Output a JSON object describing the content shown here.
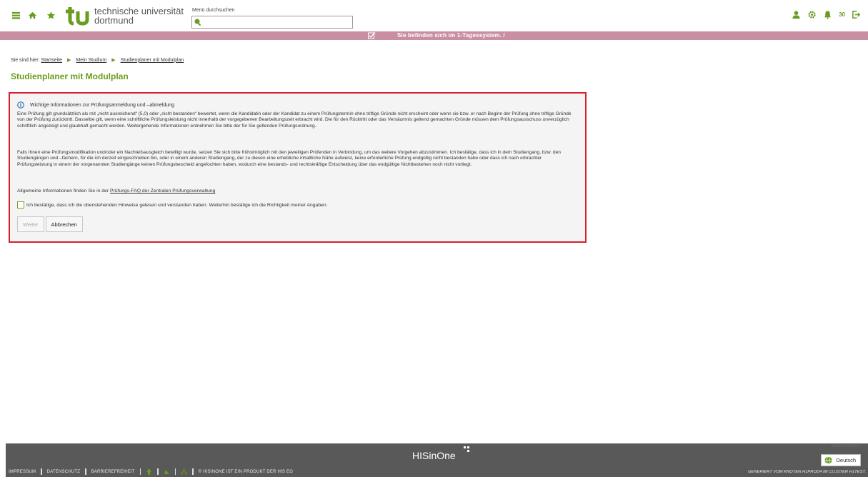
{
  "header": {
    "logo_line1": "technische universität",
    "logo_line2": "dortmund",
    "search_label": "Menü durchsuchen",
    "search_value": "",
    "notification_count": "30",
    "icons": [
      "menu-icon",
      "home-icon",
      "star-icon",
      "search-icon",
      "user-icon",
      "gear-icon",
      "bell-icon",
      "logout-icon"
    ]
  },
  "system_bar": {
    "text": "Sie befinden sich im 1-Tagessystem. /",
    "color": "#c98fa1"
  },
  "breadcrumb": {
    "prefix": "Sie sind hier:",
    "items": [
      "Startseite",
      "Mein Studium",
      "Studienplaner mit Modulplan"
    ]
  },
  "page": {
    "title": "Studienplaner mit Modulplan"
  },
  "panel": {
    "heading": "Wichtige Informationen zur Prüfungsanmeldung und –abmeldung",
    "paragraph1": "Eine Prüfung gilt grundsätzlich als mit „nicht ausreichend“ (5,0) oder „nicht bestanden“ bewertet, wenn die Kandidatin oder der Kandidat zu einem Prüfungstermin ohne triftige Gründe nicht erscheint oder wenn sie bzw. er nach Beginn der Prüfung ohne triftige Gründe von der Prüfung zurücktritt. Dasselbe gilt, wenn eine schriftliche Prüfungsleistung nicht innerhalb der vorgegebenen Bearbeitungszeit erbracht wird. Die für den Rücktritt oder das Versäumnis geltend gemachten Gründe müssen dem Prüfungsausschuss unverzüglich schriftlich angezeigt und glaubhaft gemacht werden. Weitergehende Informationen entnehmen Sie bitte der für Sie geltenden Prüfungsordnung.",
    "paragraph2": "Falls Ihnen eine Prüfungsmodifikation und/oder ein Nachteilsausgleich bewilligt wurde, setzen Sie sich bitte frühstmöglich mit den jeweiligen Prüfenden in Verbindung, um das weitere Vorgehen abzustimmen. Ich bestätige, dass ich in dem Studiengang, bzw. den Studiengängen und –fächern, für die ich derzeit eingeschrieben bin, oder in einem anderen Studiengang, der zu diesen eine erhebliche inhaltliche Nähe aufweist, keine erforderliche Prüfung endgültig nicht bestanden habe oder dass ich nach erbrachter Prüfungsleistung in einem der vorgenannten Studiengänge keinen Prüfungsbescheid angefochten haben, wodurch eine bestands- und rechtskräftige Entscheidung über das endgültige Nichtbestehen noch nicht vorliegt.",
    "faq_prefix": "Allgemeine Informationen finden Sie in der",
    "faq_link": "Prüfungs-FAQ der Zentralen Prüfungsverwaltung",
    "checkbox_label": "Ich bestätige, dass ich die obenstehenden Hinweise gelesen und verstanden haben. Weiterhin bestätige ich die Richtigkeit meiner Angaben.",
    "checkbox_checked": false,
    "button_next": "Weiter",
    "button_cancel": "Abbrechen",
    "border_color": "#d4202e"
  },
  "footer": {
    "brand": "HISinOne",
    "links": [
      "IMPRESSUM",
      "DATENSCHUTZ",
      "BARRIEREFREIHEIT"
    ],
    "copyright": "© HISINONE IST EIN PRODUKT DER HIS EG",
    "node_info": "GENERIERT VOM KNOTEN H1PROD4 IM CLUSTER H1TEST.",
    "language": "Deutsch",
    "ghost_text": "Barrierefreiheit"
  },
  "colors": {
    "accent_green": "#6a9c1f",
    "footer_bg": "#595959"
  }
}
